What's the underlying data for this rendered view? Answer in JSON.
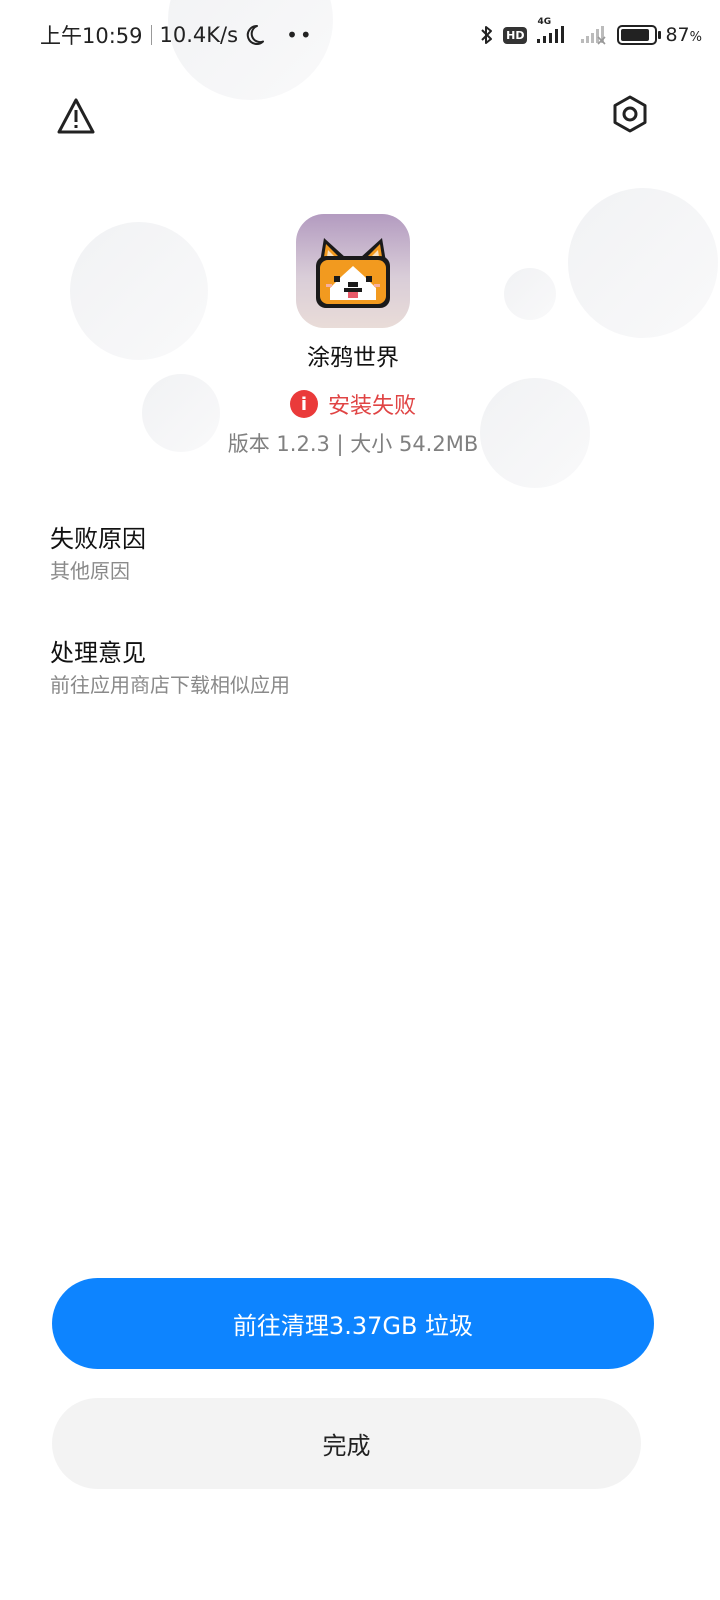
{
  "status_bar": {
    "time": "上午10:59",
    "net_speed": "10.4K/s",
    "moon_icon": "moon-icon",
    "dots": "••",
    "bluetooth_icon": "bluetooth-icon",
    "hd_badge": "HD",
    "network_type": "4G",
    "signal_icon": "signal-icon",
    "battery_percent": "87",
    "battery_unit": "%",
    "battery_level": 0.87
  },
  "toolbar": {
    "warning_icon": "warning-icon",
    "settings_icon": "settings-icon"
  },
  "app": {
    "name": "涂鸦世界",
    "status": "安装失败",
    "version_info": "版本 1.2.3 | 大小 54.2MB",
    "icon": "corgi-app-icon"
  },
  "sections": [
    {
      "title": "失败原因",
      "value": "其他原因"
    },
    {
      "title": "处理意见",
      "value": "前往应用商店下载相似应用"
    }
  ],
  "buttons": {
    "clean_label": "前往清理3.37GB 垃圾",
    "done_label": "完成"
  },
  "colors": {
    "primary": "#0d84ff",
    "error": "#e04444",
    "secondary_bg": "#f3f3f3"
  }
}
